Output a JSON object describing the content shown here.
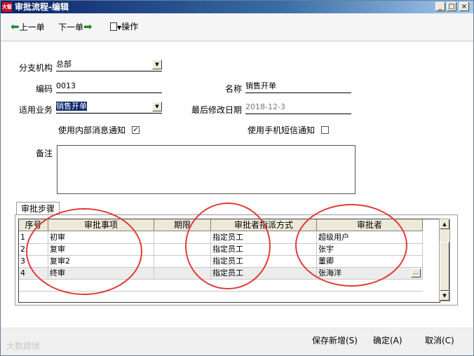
{
  "window": {
    "title": "审批流程-编辑",
    "app_icon_text": "大智"
  },
  "titlebar_buttons": {
    "minimize": "_",
    "maximize": "□",
    "close": "×"
  },
  "toolbar": {
    "prev_label": "上一单",
    "next_label": "下一单",
    "ops_label": "操作"
  },
  "form": {
    "branch_label": "分支机构",
    "branch_value": "总部",
    "code_label": "编码",
    "code_value": "0013",
    "name_label": "名称",
    "name_value": "销售开单",
    "business_label": "适用业务",
    "business_value": "销售开单",
    "modified_label": "最后修改日期",
    "modified_value": "2018-12-3",
    "internal_notify_label": "使用内部消息通知",
    "internal_notify_checked": true,
    "sms_notify_label": "使用手机短信通知",
    "sms_notify_checked": false,
    "remark_label": "备注",
    "remark_value": ""
  },
  "steps_tab": {
    "label": "审批步骤"
  },
  "grid": {
    "columns": [
      "序号",
      "审批事项",
      "期限",
      "审批者指派方式",
      "审批者"
    ],
    "rows": [
      {
        "seq": "1",
        "item": "初审",
        "term": "",
        "method": "指定员工",
        "approver": "超级用户"
      },
      {
        "seq": "2",
        "item": "复审",
        "term": "",
        "method": "指定员工",
        "approver": "张宇"
      },
      {
        "seq": "3",
        "item": "复审2",
        "term": "",
        "method": "指定员工",
        "approver": "董卿"
      },
      {
        "seq": "4",
        "item": "终审",
        "term": "",
        "method": "指定员工",
        "approver": "张海洋"
      }
    ],
    "ellipsis": "..."
  },
  "footer": {
    "save_new": "保存新增(S)",
    "confirm": "确定(A)",
    "cancel": "取消(C)",
    "watermark": "大数跨境"
  },
  "icons": {
    "prev": "arrow-left-icon",
    "next": "arrow-right-icon",
    "ops": "document-icon",
    "dropdown": "chevron-down-icon"
  },
  "colors": {
    "titlebar": "#0a246a",
    "arrow": "#1a8a2e",
    "annotation_circle": "#e23a3a",
    "selection": "#0a246a"
  }
}
